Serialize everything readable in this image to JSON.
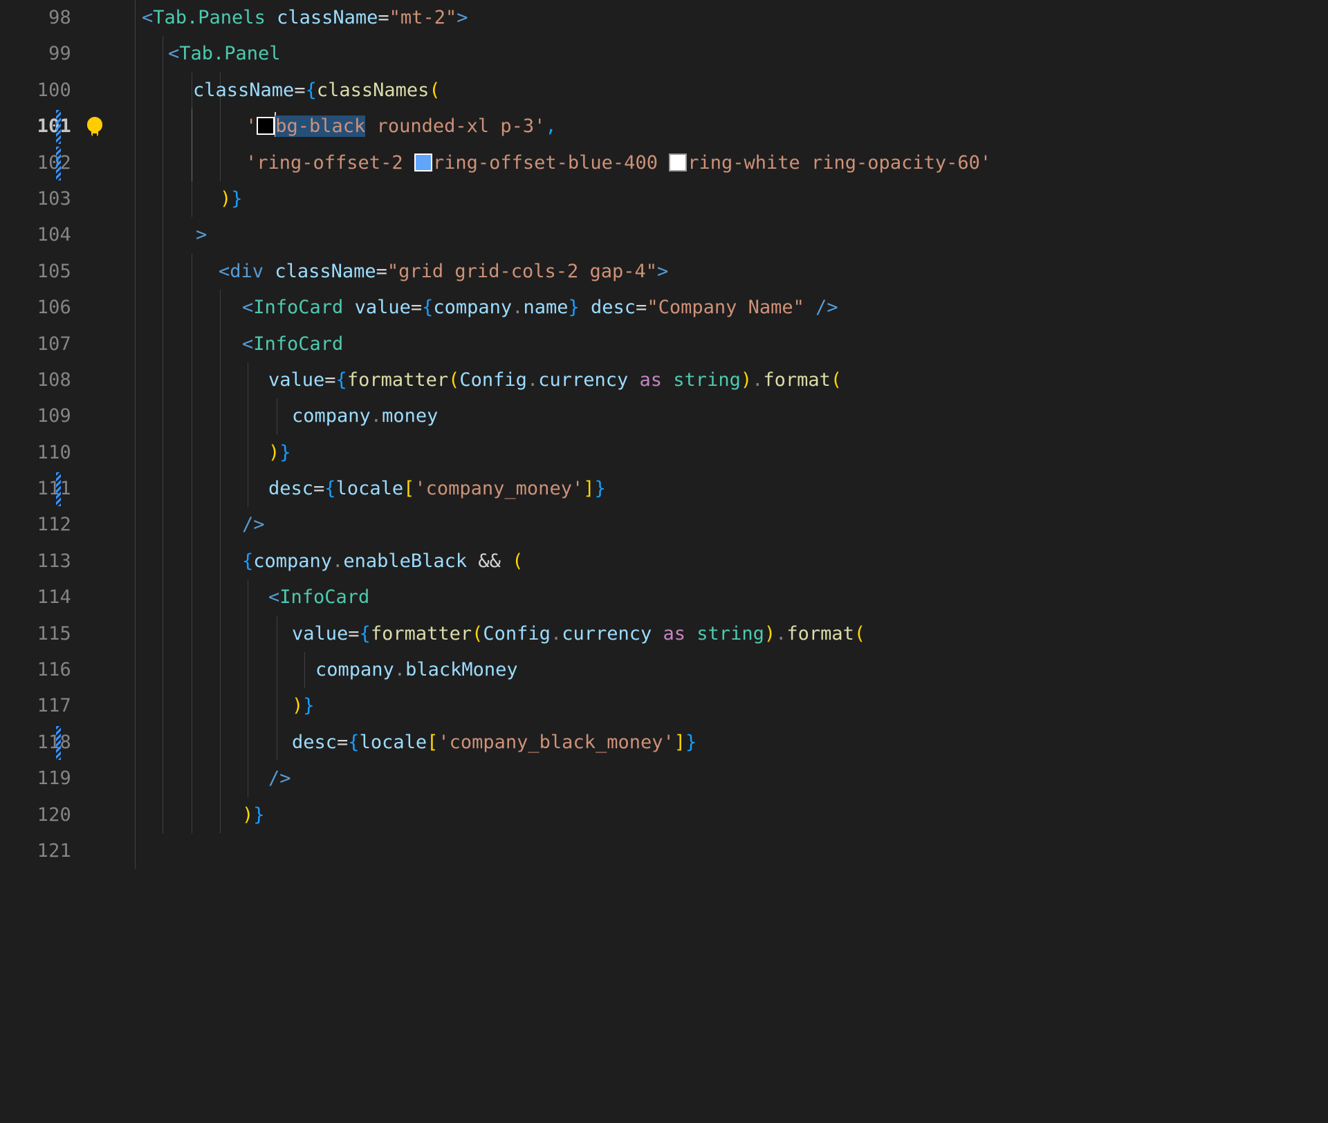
{
  "editor": {
    "app": "code-editor",
    "theme": "dark-plus",
    "language": "typescriptreact",
    "first_line": 98,
    "last_line": 121,
    "current_line": 101,
    "colors": {
      "background": "#1e1e1e",
      "line_number": "#858585",
      "line_number_active": "#c6c6c6",
      "selection": "#264f78",
      "indent_guide": "#404040",
      "indent_guide_active": "#707070",
      "change_marker": "#3794ff",
      "lightbulb": "#ffcc00",
      "tag": "#4ec9b0",
      "html_tag": "#569cd6",
      "attribute": "#9cdcfe",
      "string": "#ce9178",
      "function": "#dcdcaa",
      "keyword": "#c586c0",
      "type": "#4ec9b0",
      "bracket_1": "#ffd700",
      "bracket_2": "#da70d6",
      "bracket_3": "#179fff"
    },
    "gutter": {
      "lightbulb_line": 101,
      "lightbulb_title": "code-action-lightbulb",
      "change_marker_lines": [
        101,
        102,
        111,
        118
      ]
    },
    "selection": {
      "line": 101,
      "text": "bg-black"
    },
    "color_swatches": [
      {
        "line": 101,
        "token": "bg-black",
        "color": "#000000"
      },
      {
        "line": 102,
        "token": "ring-offset-blue-400",
        "color": "#60a5fa"
      },
      {
        "line": 102,
        "token": "ring-white",
        "color": "#ffffff"
      }
    ],
    "lines": [
      {
        "n": 98,
        "text": "      <Tab.Panels className=\"mt-2\">"
      },
      {
        "n": 99,
        "text": "        <Tab.Panel"
      },
      {
        "n": 100,
        "text": "          className={classNames("
      },
      {
        "n": 101,
        "text": "            '■bg-black rounded-xl p-3',"
      },
      {
        "n": 102,
        "text": "            'ring-offset-2 ■ring-offset-blue-400 ■ring-white ring-opacity-60'"
      },
      {
        "n": 103,
        "text": "          )}"
      },
      {
        "n": 104,
        "text": "        >"
      },
      {
        "n": 105,
        "text": "          <div className=\"grid grid-cols-2 gap-4\">"
      },
      {
        "n": 106,
        "text": "            <InfoCard value={company.name} desc=\"Company Name\" />"
      },
      {
        "n": 107,
        "text": "            <InfoCard"
      },
      {
        "n": 108,
        "text": "              value={formatter(Config.currency as string).format("
      },
      {
        "n": 109,
        "text": "                company.money"
      },
      {
        "n": 110,
        "text": "              )}"
      },
      {
        "n": 111,
        "text": "              desc={locale['company_money']}"
      },
      {
        "n": 112,
        "text": "            />"
      },
      {
        "n": 113,
        "text": "            {company.enableBlack && ("
      },
      {
        "n": 114,
        "text": "              <InfoCard"
      },
      {
        "n": 115,
        "text": "                value={formatter(Config.currency as string).format("
      },
      {
        "n": 116,
        "text": "                  company.blackMoney"
      },
      {
        "n": 117,
        "text": "                )}"
      },
      {
        "n": 118,
        "text": "                desc={locale['company_black_money']}"
      },
      {
        "n": 119,
        "text": "              />"
      },
      {
        "n": 120,
        "text": "            )}"
      },
      {
        "n": 121,
        "text": ""
      }
    ],
    "line_numbers": [
      "98",
      "99",
      "100",
      "101",
      "102",
      "103",
      "104",
      "105",
      "106",
      "107",
      "108",
      "109",
      "110",
      "111",
      "112",
      "113",
      "114",
      "115",
      "116",
      "117",
      "118",
      "119",
      "120",
      "121"
    ]
  }
}
